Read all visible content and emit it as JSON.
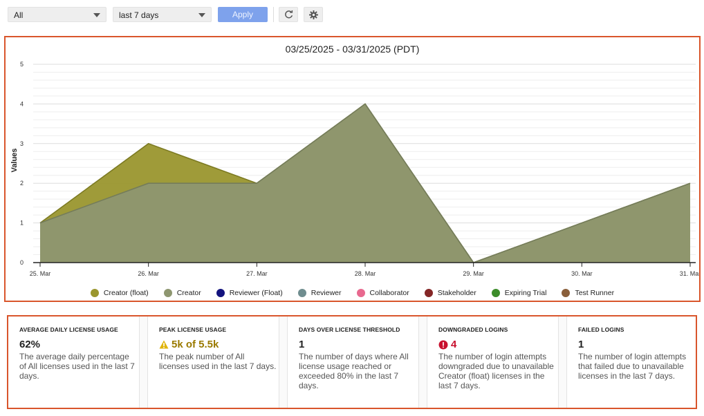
{
  "toolbar": {
    "filter_select": "All",
    "range_select": "last 7 days",
    "apply_label": "Apply",
    "refresh_icon": "refresh-icon",
    "settings_icon": "gear-icon"
  },
  "chart_data": {
    "type": "area",
    "title": "03/25/2025 - 03/31/2025 (PDT)",
    "xlabel": "",
    "ylabel": "Values",
    "x": [
      "25. Mar",
      "26. Mar",
      "27. Mar",
      "28. Mar",
      "29. Mar",
      "30. Mar",
      "31. Mar"
    ],
    "ylim": [
      0,
      5
    ],
    "yticks": [
      0,
      1,
      2,
      3,
      4,
      5
    ],
    "grid": true,
    "legend_position": "bottom",
    "series": [
      {
        "name": "Creator (float)",
        "color": "#9a962e",
        "values": [
          1,
          3,
          2,
          4,
          0,
          1,
          2
        ]
      },
      {
        "name": "Creator",
        "color": "#8e9670",
        "values": [
          1,
          2,
          2,
          4,
          0,
          1,
          2
        ]
      },
      {
        "name": "Reviewer (Float)",
        "color": "#13137e",
        "values": [
          0,
          0,
          0,
          0,
          0,
          0,
          0
        ]
      },
      {
        "name": "Reviewer",
        "color": "#6f8d8f",
        "values": [
          0,
          0,
          0,
          0,
          0,
          0,
          0
        ]
      },
      {
        "name": "Collaborator",
        "color": "#e8698f",
        "values": [
          0,
          0,
          0,
          0,
          0,
          0,
          0
        ]
      },
      {
        "name": "Stakeholder",
        "color": "#842626",
        "values": [
          0,
          0,
          0,
          0,
          0,
          0,
          0
        ]
      },
      {
        "name": "Expiring Trial",
        "color": "#3c8c2a",
        "values": [
          0,
          0,
          0,
          0,
          0,
          0,
          0
        ]
      },
      {
        "name": "Test Runner",
        "color": "#8a5f3a",
        "values": [
          0,
          0,
          0,
          0,
          0,
          0,
          0
        ]
      }
    ]
  },
  "metrics": [
    {
      "title": "AVERAGE DAILY LICENSE USAGE",
      "value": "62%",
      "desc": "The average daily percentage of All licenses used in the last 7 days.",
      "status": "normal"
    },
    {
      "title": "PEAK LICENSE USAGE",
      "value": "5k of 5.5k",
      "desc": "The peak number of All licenses used in the last 7 days.",
      "status": "warning",
      "icon": "warning-icon"
    },
    {
      "title": "DAYS OVER LICENSE THRESHOLD",
      "value": "1",
      "desc": "The number of days where All license usage reached or exceeded 80% in the last 7 days.",
      "status": "normal"
    },
    {
      "title": "DOWNGRADED LOGINS",
      "value": "4",
      "desc": "The number of login attempts downgraded due to unavailable Creator (float) licenses in the last 7 days.",
      "status": "error",
      "icon": "error-icon"
    },
    {
      "title": "FAILED LOGINS",
      "value": "1",
      "desc": "The number of login attempts that failed due to unavailable licenses in the last 7 days.",
      "status": "normal"
    }
  ]
}
